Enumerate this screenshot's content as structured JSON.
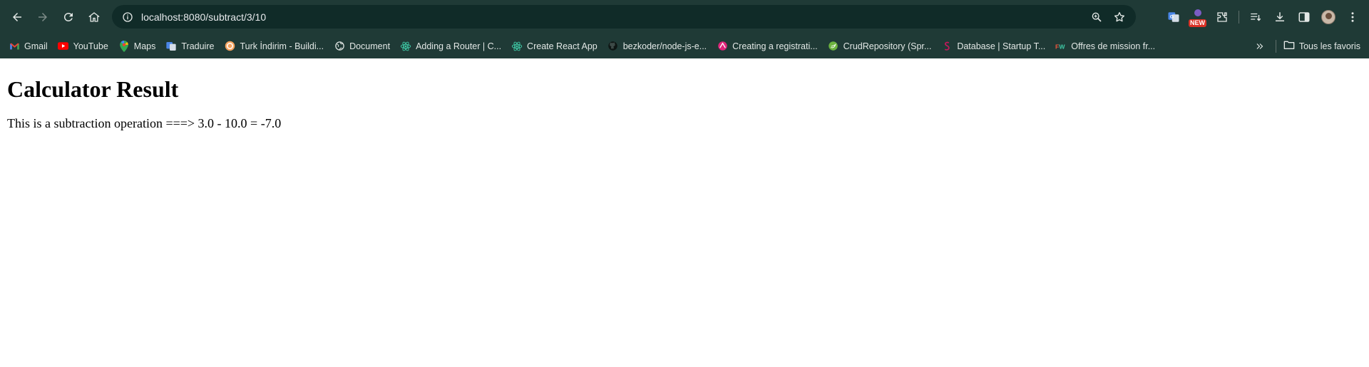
{
  "browser": {
    "url": "localhost:8080/subtract/3/10",
    "new_badge": "NEW",
    "colors": {
      "frame": "#1f3a36",
      "omnibox": "#102b28"
    }
  },
  "bookmarks": [
    {
      "label": "Gmail",
      "icon": "gmail-icon"
    },
    {
      "label": "YouTube",
      "icon": "youtube-icon"
    },
    {
      "label": "Maps",
      "icon": "maps-icon"
    },
    {
      "label": "Traduire",
      "icon": "translate-icon"
    },
    {
      "label": "Turk İndirim - Buildi...",
      "icon": "turk-indirim-icon"
    },
    {
      "label": "Document",
      "icon": "globe-icon"
    },
    {
      "label": "Adding a Router | C...",
      "icon": "react-icon"
    },
    {
      "label": "Create React App",
      "icon": "react-icon"
    },
    {
      "label": "bezkoder/node-js-e...",
      "icon": "github-icon"
    },
    {
      "label": "Creating a registrati...",
      "icon": "pink-logo-icon"
    },
    {
      "label": "CrudRepository (Spr...",
      "icon": "spring-icon"
    },
    {
      "label": "Database | Startup T...",
      "icon": "startup-icon"
    },
    {
      "label": "Offres de mission fr...",
      "icon": "fw-icon"
    }
  ],
  "all_bookmarks_label": "Tous les favoris",
  "page": {
    "title": "Calculator Result",
    "result_text": "This is a subtraction operation ===> 3.0 - 10.0 = -7.0"
  }
}
